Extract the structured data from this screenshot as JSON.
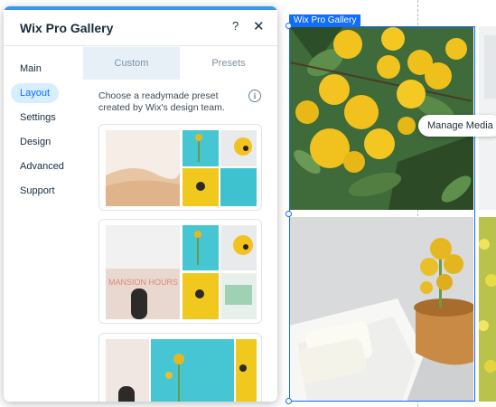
{
  "panel": {
    "title": "Wix Pro Gallery",
    "help_label": "?",
    "close_label": "✕",
    "nav": [
      {
        "label": "Main",
        "active": false
      },
      {
        "label": "Layout",
        "active": true
      },
      {
        "label": "Settings",
        "active": false
      },
      {
        "label": "Design",
        "active": false
      },
      {
        "label": "Advanced",
        "active": false
      },
      {
        "label": "Support",
        "active": false
      }
    ],
    "tabs": [
      {
        "label": "Custom",
        "selected": false
      },
      {
        "label": "Presets",
        "selected": true
      }
    ],
    "description": "Choose a readymade preset created by Wix's design team.",
    "info_icon": "i",
    "presets": [
      "preset-1",
      "preset-2",
      "preset-3"
    ]
  },
  "canvas": {
    "gallery_tag": "Wix Pro Gallery",
    "manage_media": "Manage Media"
  },
  "colors": {
    "accent": "#116dff",
    "panel_topbar": "#3899ec",
    "active_nav_bg": "#d6eeff"
  }
}
